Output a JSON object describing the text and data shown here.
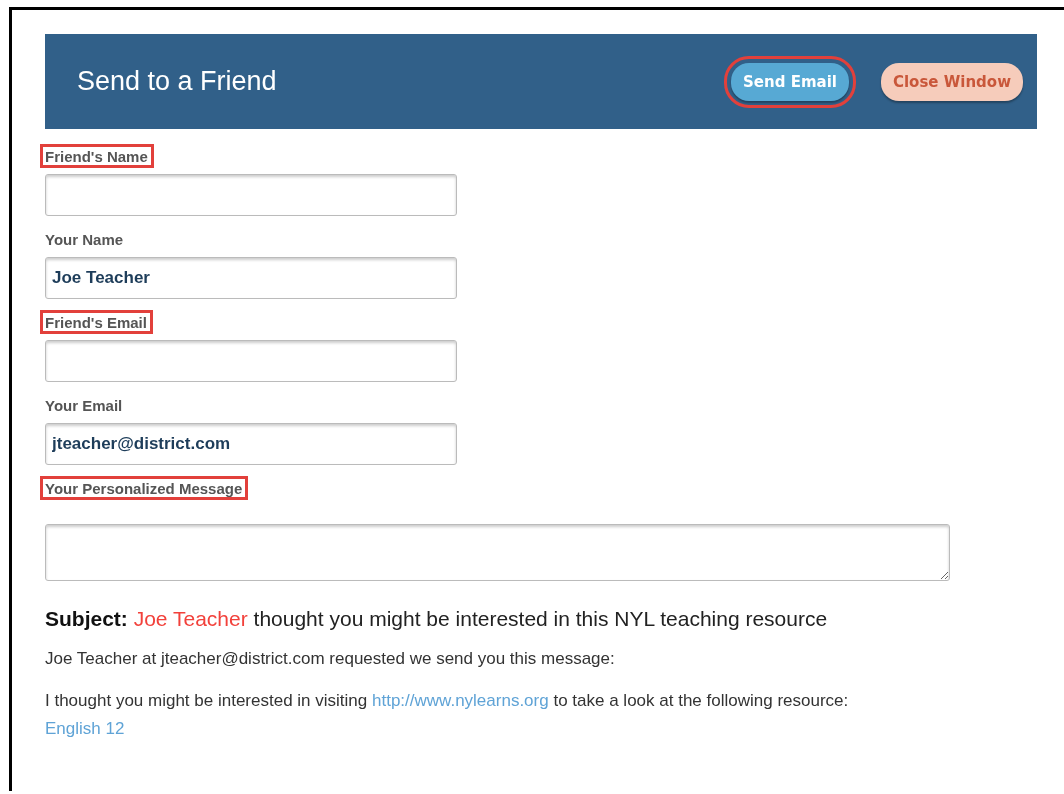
{
  "header": {
    "title": "Send to a Friend",
    "buttons": [
      {
        "label": "Send Email",
        "kind": "primary",
        "highlighted": true
      },
      {
        "label": "Close Window",
        "kind": "secondary",
        "highlighted": false
      }
    ]
  },
  "fields": [
    {
      "label": "Friend's Name",
      "kind": "input",
      "highlighted": true
    },
    {
      "label": "Your Name",
      "kind": "input",
      "value": "Joe Teacher",
      "highlighted": false
    },
    {
      "label": "Friend's Email",
      "kind": "input",
      "highlighted": true
    },
    {
      "label": "Your Email",
      "kind": "input",
      "value": "jteacher@district.com",
      "highlighted": false
    },
    {
      "label": "Your Personalized Message",
      "kind": "textarea",
      "highlighted": true
    }
  ],
  "subject": {
    "label": "Subject:",
    "name": "Joe Teacher",
    "text": "thought you might be interested in this NYL teaching resource"
  },
  "intro": "Joe Teacher at jteacher@district.com requested we send you this message:",
  "message": {
    "before": "I thought you might be interested in visiting",
    "link": "http://www.nylearns.org",
    "middle": "to take a look at the following resource:",
    "resource_link": "English 12"
  }
}
